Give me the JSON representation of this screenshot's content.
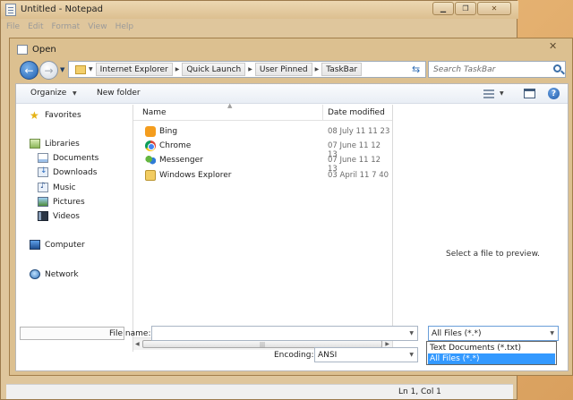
{
  "notepad": {
    "title": "Untitled - Notepad",
    "menu": [
      "File",
      "Edit",
      "Format",
      "View",
      "Help"
    ],
    "status": "Ln 1, Col 1",
    "controls": {
      "minimize": "▁",
      "maximize": "❐",
      "close": "✕"
    }
  },
  "dialog": {
    "title": "Open",
    "close": "✕",
    "address": [
      "Internet Explorer",
      "Quick Launch",
      "User Pinned",
      "TaskBar"
    ],
    "search_placeholder": "Search TaskBar",
    "toolbar": {
      "organize": "Organize",
      "new_folder": "New folder",
      "help": "?"
    },
    "nav": {
      "favorites": "Favorites",
      "libraries": "Libraries",
      "library_items": [
        "Documents",
        "Downloads",
        "Music",
        "Pictures",
        "Videos"
      ],
      "computer": "Computer",
      "network": "Network"
    },
    "columns": {
      "name": "Name",
      "date": "Date modified"
    },
    "files": [
      {
        "name": "Bing",
        "date": "08 July 11 11 23",
        "icon": "bing-icon"
      },
      {
        "name": "Chrome",
        "date": "07 June 11 12 13",
        "icon": "chrome-icon"
      },
      {
        "name": "Messenger",
        "date": "07 June 11 12 13",
        "icon": "messenger-icon"
      },
      {
        "name": "Windows Explorer",
        "date": "03 April 11 7 40",
        "icon": "windows-explorer-icon"
      }
    ],
    "preview_text": "Select a file to preview.",
    "file_name_label": "File name:",
    "file_name_value": "",
    "encoding_label": "Encoding:",
    "encoding_value": "ANSI",
    "file_type_value": "All Files  (*.*)",
    "file_type_options": [
      "Text Documents (*.txt)",
      "All Files  (*.*)"
    ],
    "selected_type_index": 1
  }
}
